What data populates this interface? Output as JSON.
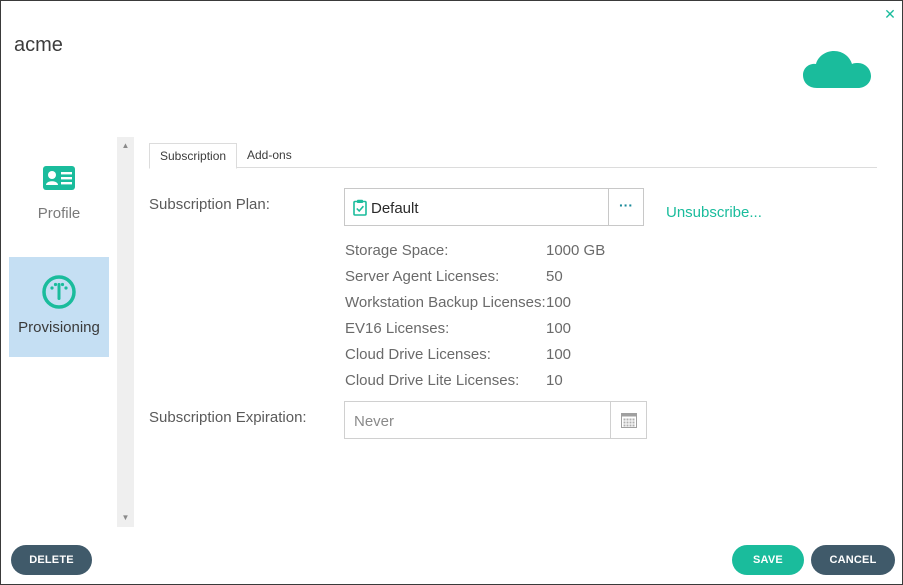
{
  "header": {
    "title": "acme",
    "close_icon": "close-icon",
    "cloud_icon": "cloud-icon",
    "accent": "#1abc9c"
  },
  "sidebar": {
    "items": [
      {
        "label": "Profile",
        "icon": "contact-card-icon",
        "active": false
      },
      {
        "label": "Provisioning",
        "icon": "gauge-icon",
        "active": true
      }
    ]
  },
  "tabs": [
    {
      "label": "Subscription",
      "active": true
    },
    {
      "label": "Add-ons",
      "active": false
    }
  ],
  "subscription": {
    "plan_label": "Subscription Plan:",
    "plan_value": "Default",
    "more_label": "···",
    "unsubscribe_label": "Unsubscribe...",
    "details": [
      {
        "label": "Storage Space:",
        "value": "1000 GB"
      },
      {
        "label": "Server Agent Licenses:",
        "value": "50"
      },
      {
        "label": "Workstation Backup Licenses:",
        "value": "100"
      },
      {
        "label": "EV16 Licenses:",
        "value": "100"
      },
      {
        "label": "Cloud Drive Licenses:",
        "value": "100"
      },
      {
        "label": "Cloud Drive Lite Licenses:",
        "value": "10"
      }
    ],
    "expiration_label": "Subscription Expiration:",
    "expiration_value": "Never"
  },
  "buttons": {
    "delete": "DELETE",
    "save": "SAVE",
    "cancel": "CANCEL"
  },
  "colors": {
    "accent": "#1abc9c",
    "dark_button": "#405a6a",
    "selected_bg": "#c5dff3"
  }
}
